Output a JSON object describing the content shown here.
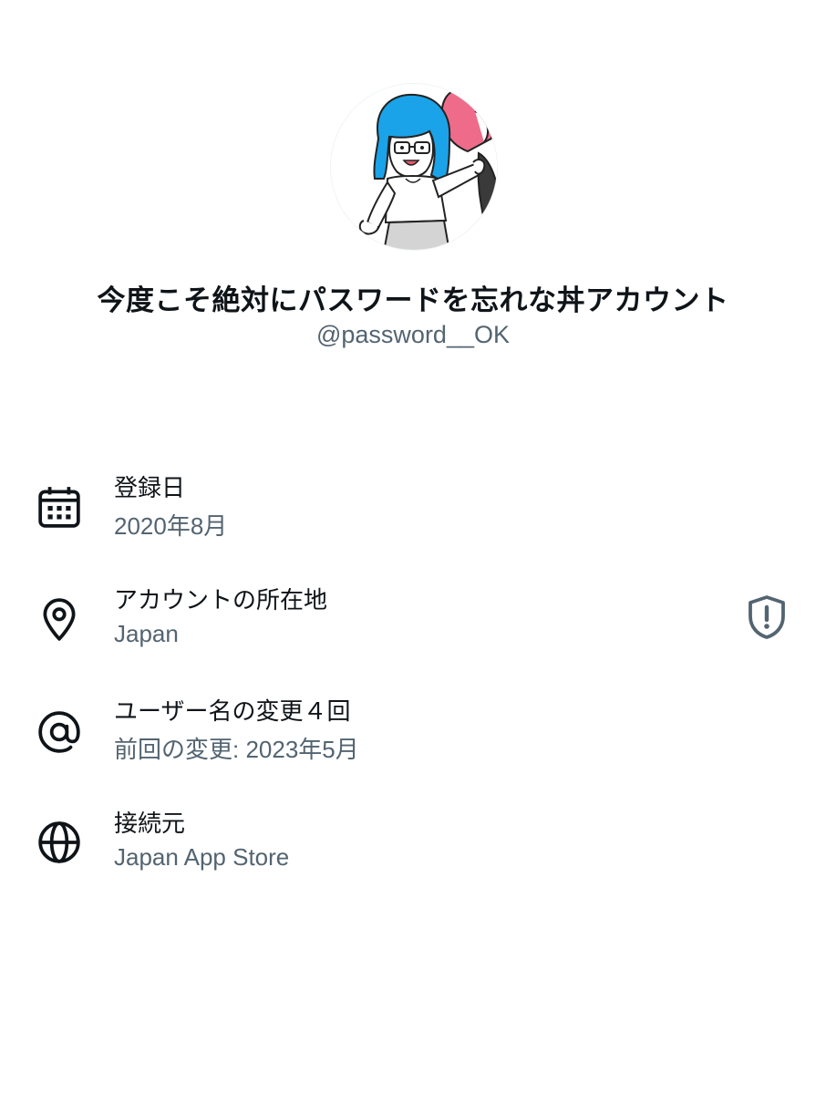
{
  "profile": {
    "display_name": "今度こそ絶対にパスワードを忘れな丼アカウント",
    "handle": "@password__OK",
    "avatar_icon": "avatar-illustration"
  },
  "info": [
    {
      "icon": "calendar-icon",
      "title": "登録日",
      "value": "2020年8月"
    },
    {
      "icon": "location-pin-icon",
      "title": "アカウントの所在地",
      "value": "Japan",
      "badge_icon": "shield-alert-icon"
    },
    {
      "icon": "at-sign-icon",
      "title": "ユーザー名の変更４回",
      "value": "前回の変更: 2023年5月"
    },
    {
      "icon": "globe-icon",
      "title": "接続元",
      "value": "Japan App Store"
    }
  ],
  "colors": {
    "primary_text": "#0f1419",
    "secondary_text": "#536471",
    "icon_gray": "#536471"
  }
}
